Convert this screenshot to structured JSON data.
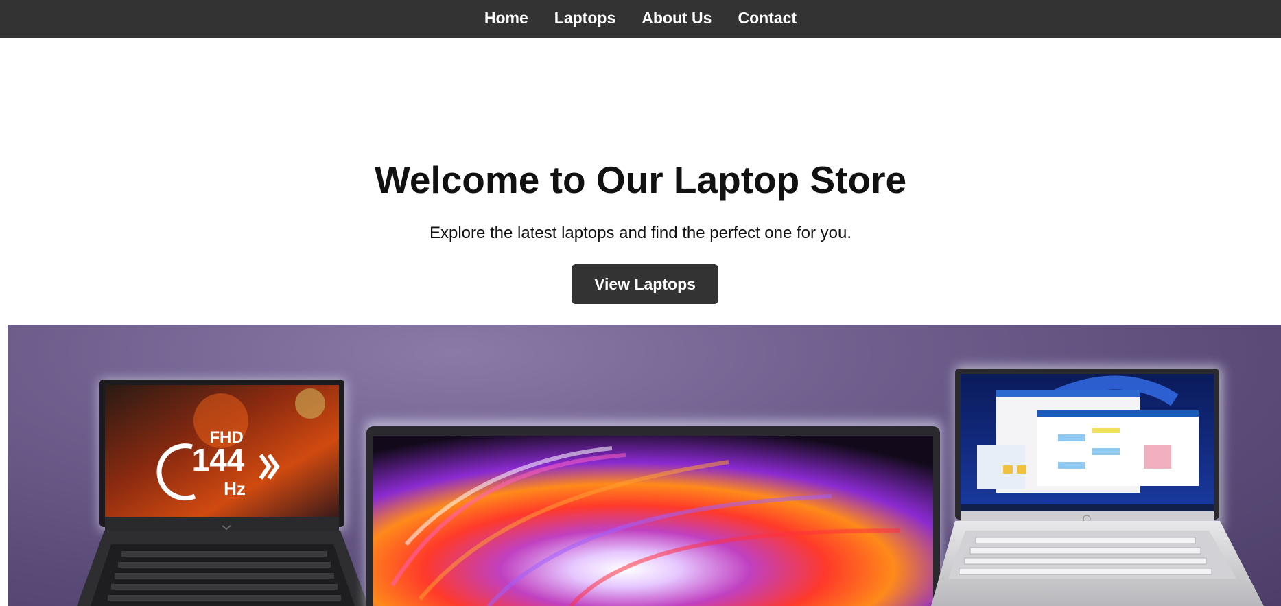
{
  "nav": {
    "items": [
      {
        "label": "Home"
      },
      {
        "label": "Laptops"
      },
      {
        "label": "About Us"
      },
      {
        "label": "Contact"
      }
    ]
  },
  "hero": {
    "title": "Welcome to Our Laptop Store",
    "subtitle": "Explore the latest laptops and find the perfect one for you.",
    "cta_label": "View Laptops"
  },
  "banner": {
    "left_laptop_screen_text": {
      "line1": "FHD",
      "line2": "144",
      "line3": "Hz"
    }
  },
  "colors": {
    "nav_bg": "#333333",
    "button_bg": "#333333",
    "text": "#111111",
    "banner_purple": "#6f5f8e"
  }
}
